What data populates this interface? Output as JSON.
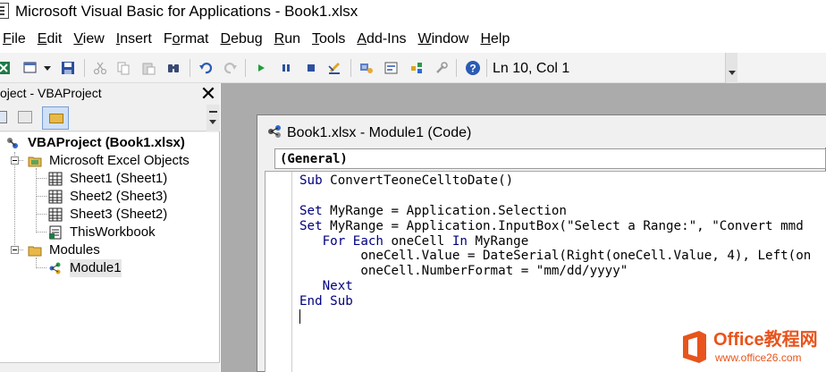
{
  "window": {
    "title": "Microsoft Visual Basic for Applications - Book1.xlsx"
  },
  "menubar": {
    "items": [
      {
        "label": "File",
        "accelerator": "F"
      },
      {
        "label": "Edit",
        "accelerator": "E"
      },
      {
        "label": "View",
        "accelerator": "V"
      },
      {
        "label": "Insert",
        "accelerator": "I"
      },
      {
        "label": "Format",
        "accelerator": "o"
      },
      {
        "label": "Debug",
        "accelerator": "D"
      },
      {
        "label": "Run",
        "accelerator": "R"
      },
      {
        "label": "Tools",
        "accelerator": "T"
      },
      {
        "label": "Add-Ins",
        "accelerator": "A"
      },
      {
        "label": "Window",
        "accelerator": "W"
      },
      {
        "label": "Help",
        "accelerator": "H"
      }
    ]
  },
  "toolbar": {
    "position_readout": "Ln 10, Col 1",
    "icons": [
      "view-excel-icon",
      "insert-module-icon",
      "save-icon",
      "cut-icon",
      "copy-icon",
      "paste-icon",
      "find-icon",
      "undo-icon",
      "redo-icon",
      "run-icon",
      "break-icon",
      "reset-icon",
      "design-mode-icon",
      "project-explorer-icon",
      "properties-icon",
      "object-browser-icon",
      "toolbox-icon",
      "help-icon"
    ]
  },
  "project_pane": {
    "title": "oject - VBAProject",
    "close_glyph": "✕",
    "tree": {
      "root": "VBAProject (Book1.xlsx)",
      "excel_objects_folder": "Microsoft Excel Objects",
      "sheets": [
        "Sheet1 (Sheet1)",
        "Sheet2 (Sheet3)",
        "Sheet3 (Sheet2)"
      ],
      "workbook": "ThisWorkbook",
      "modules_folder": "Modules",
      "modules": [
        "Module1"
      ]
    }
  },
  "code_window": {
    "title": "Book1.xlsx - Module1 (Code)",
    "object_select": "(General)",
    "code_lines": [
      [
        {
          "t": "Sub",
          "k": true
        },
        {
          "t": " ConvertTeoneCelltoDate()"
        }
      ],
      [
        {
          "t": ""
        }
      ],
      [
        {
          "t": "Set",
          "k": true
        },
        {
          "t": " MyRange = Application.Selection"
        }
      ],
      [
        {
          "t": "Set",
          "k": true
        },
        {
          "t": " MyRange = Application.InputBox(\"Select a Range:\", \"Convert mmd"
        }
      ],
      [
        {
          "t": "   "
        },
        {
          "t": "For Each",
          "k": true
        },
        {
          "t": " oneCell "
        },
        {
          "t": "In",
          "k": true
        },
        {
          "t": " MyRange"
        }
      ],
      [
        {
          "t": "        oneCell.Value = DateSerial(Right(oneCell.Value, 4), Left(on"
        }
      ],
      [
        {
          "t": "        oneCell.NumberFormat = \"mm/dd/yyyy\""
        }
      ],
      [
        {
          "t": "   "
        },
        {
          "t": "Next",
          "k": true
        }
      ],
      [
        {
          "t": "End Sub",
          "k": true
        }
      ]
    ]
  },
  "watermark": {
    "brand": "Office教程网",
    "url": "www.office26.com"
  },
  "colors": {
    "keyword": "#00007f",
    "mdi_background": "#ababab",
    "watermark": "#e8541c"
  }
}
